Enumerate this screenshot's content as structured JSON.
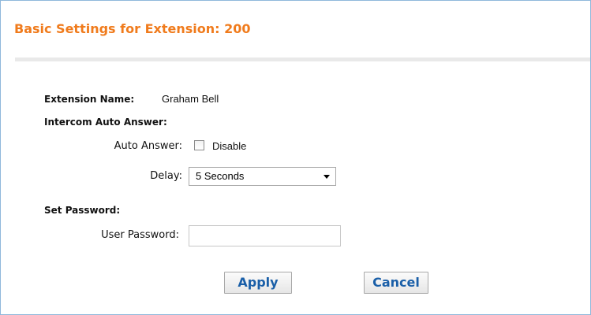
{
  "header": {
    "title": "Basic Settings for Extension: 200"
  },
  "extension": {
    "name_label": "Extension Name:",
    "name_value": "Graham Bell"
  },
  "intercom": {
    "section_label": "Intercom Auto Answer:",
    "auto_answer_label": "Auto Answer:",
    "auto_answer_checkbox_label": "Disable",
    "auto_answer_checked": false,
    "delay_label": "Delay:",
    "delay_selected": "5 Seconds"
  },
  "password": {
    "section_label": "Set Password:",
    "user_password_label": "User Password:",
    "user_password_value": ""
  },
  "actions": {
    "apply_label": "Apply",
    "cancel_label": "Cancel"
  },
  "colors": {
    "title": "#f07b1c",
    "button_text": "#1a5fa8",
    "frame_border": "#8fb8db"
  }
}
